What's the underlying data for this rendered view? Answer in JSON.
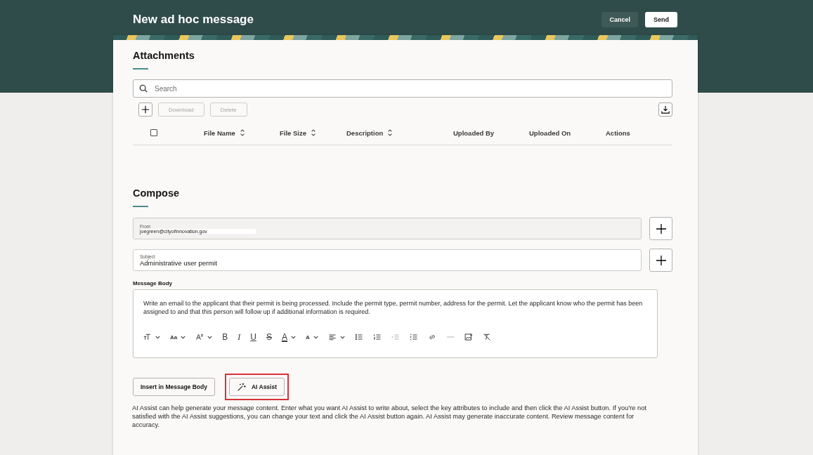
{
  "header": {
    "title": "New ad hoc message",
    "buttons": [
      {
        "label": "Cancel",
        "kind": "secondary"
      },
      {
        "label": "Send",
        "kind": "primary"
      }
    ]
  },
  "attachments": {
    "title": "Attachments",
    "search": {
      "placeholder": "Search"
    },
    "actions": [
      {
        "label": "Download",
        "disabled": true
      },
      {
        "label": "Delete",
        "disabled": true
      }
    ],
    "select_all": {
      "checked": false
    },
    "columns": [
      {
        "label": "File Name",
        "sortable": true
      },
      {
        "label": "File Size",
        "sortable": true
      },
      {
        "label": "Description",
        "sortable": true
      },
      {
        "label": "Uploaded By",
        "sortable": false
      },
      {
        "label": "Uploaded On",
        "sortable": false
      },
      {
        "label": "Actions",
        "sortable": false
      }
    ]
  },
  "compose": {
    "title": "Compose",
    "from": {
      "label": "From",
      "value": "joegreen@cityofinnovation.gov",
      "disabled": true
    },
    "subject": {
      "label": "Subject",
      "value": "Administrative user permit",
      "disabled": false
    },
    "body_label": "Message Body",
    "body": "Write an email to the applicant that their permit is being processed. Include the permit type, permit number, address for the permit. Let the applicant know who the permit has been assigned to and that this person will follow up if additional information is required.",
    "toolbar": [
      {
        "kind": "icon",
        "dropdown": true,
        "disabled": false
      },
      {
        "kind": "size",
        "label": "Aa",
        "dropdown": true,
        "disabled": false
      },
      {
        "kind": "icon",
        "dropdown": true,
        "disabled": false
      },
      {
        "kind": "bold",
        "label": "B",
        "dropdown": false,
        "disabled": false
      },
      {
        "kind": "italic",
        "label": "I",
        "dropdown": false,
        "disabled": false
      },
      {
        "kind": "underline",
        "label": "U",
        "dropdown": false,
        "disabled": false
      },
      {
        "kind": "strike",
        "label": "S",
        "dropdown": false,
        "disabled": false
      },
      {
        "kind": "color",
        "label": "A",
        "dropdown": true,
        "disabled": false
      },
      {
        "kind": "highlight",
        "label": "A",
        "dropdown": true,
        "disabled": false
      },
      {
        "kind": "icon",
        "dropdown": true,
        "disabled": false
      },
      {
        "kind": "icon",
        "dropdown": false,
        "disabled": false
      },
      {
        "kind": "icon",
        "dropdown": false,
        "disabled": false
      },
      {
        "kind": "icon",
        "dropdown": false,
        "disabled": true
      },
      {
        "kind": "icon",
        "dropdown": false,
        "disabled": false
      },
      {
        "kind": "icon",
        "dropdown": false,
        "disabled": false
      },
      {
        "kind": "icon",
        "dropdown": false,
        "disabled": true
      },
      {
        "kind": "icon",
        "dropdown": false,
        "disabled": false
      },
      {
        "kind": "icon",
        "dropdown": false,
        "disabled": false
      }
    ],
    "buttons": [
      {
        "label": "Insert in Message Body",
        "highlighted": false,
        "kind": "plain"
      },
      {
        "label": "AI Assist",
        "highlighted": true,
        "kind": "ai"
      }
    ],
    "help": "AI Assist can help generate your message content. Enter what you want AI Assist to write about, select the key attributes to include and then click the AI Assist button. If you're not satisfied with the AI Assist suggestions, you can change your text and click the AI Assist button again. AI Assist may generate inaccurate content. Review message content for accuracy."
  }
}
